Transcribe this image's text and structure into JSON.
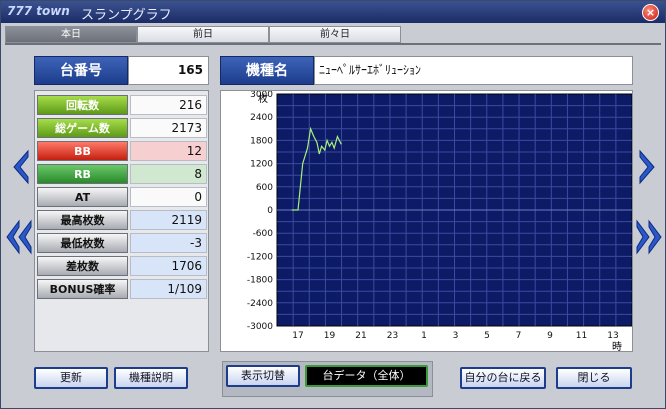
{
  "window": {
    "brand": "777 town",
    "title": "スランプグラフ",
    "close_label": "×"
  },
  "tabs": [
    {
      "label": "本日"
    },
    {
      "label": "前日"
    },
    {
      "label": "前々日"
    }
  ],
  "machine": {
    "number_label": "台番号",
    "number": "165",
    "name_label": "機種名",
    "name": "ﾆｭｰﾍﾟﾙｻｰｴﾎﾞﾘｭｰｼｮﾝ"
  },
  "stats": [
    {
      "label": "回転数",
      "value": "216"
    },
    {
      "label": "総ゲーム数",
      "value": "2173"
    },
    {
      "label": "BB",
      "value": "12"
    },
    {
      "label": "RB",
      "value": "8"
    },
    {
      "label": "AT",
      "value": "0"
    },
    {
      "label": "最高枚数",
      "value": "2119"
    },
    {
      "label": "最低枚数",
      "value": "-3"
    },
    {
      "label": "差枚数",
      "value": "1706"
    },
    {
      "label": "BONUS確率",
      "value": "1/109"
    }
  ],
  "colors": {
    "plot_bg": "#0d1b66",
    "grid": "#3a4aa0",
    "line": "#a8f07a"
  },
  "buttons": {
    "update": "更新",
    "machine_info": "機種説明",
    "toggle_display": "表示切替",
    "data_mode": "台データ（全体）",
    "my_data": "自分の台に戻る",
    "close": "閉じる"
  },
  "chart_data": {
    "type": "line",
    "ylabel": "枚",
    "xlabel": "時",
    "ylim": [
      -3000,
      3000
    ],
    "yticks": [
      3000,
      2400,
      1800,
      1200,
      600,
      0,
      -600,
      -1200,
      -1800,
      -2400,
      -3000
    ],
    "xticks": [
      "17",
      "19",
      "21",
      "23",
      "1",
      "3",
      "5",
      "7",
      "9",
      "11",
      "13"
    ],
    "grid": true,
    "series": [
      {
        "x": [
          16.6,
          17.0,
          17.3,
          17.6,
          17.8,
          18.0,
          18.2,
          18.35,
          18.5,
          18.7,
          18.85,
          19.0,
          19.15,
          19.3,
          19.5,
          19.75
        ],
        "y": [
          0,
          0,
          1200,
          1600,
          2100,
          1900,
          1750,
          1450,
          1650,
          1550,
          1800,
          1650,
          1750,
          1600,
          1900,
          1700
        ]
      }
    ]
  }
}
